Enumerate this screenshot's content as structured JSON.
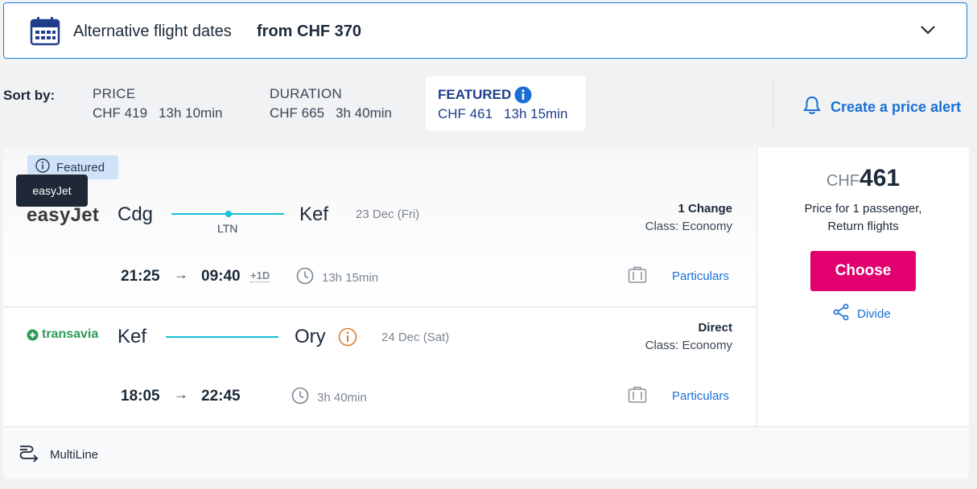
{
  "alt_dates": {
    "label": "Alternative flight dates",
    "price": "from CHF 370"
  },
  "sort": {
    "label": "Sort by:",
    "options": [
      {
        "title": "PRICE",
        "price": "CHF 419",
        "duration": "13h 10min"
      },
      {
        "title": "DURATION",
        "price": "CHF 665",
        "duration": "3h 40min"
      },
      {
        "title": "FEATURED",
        "price": "CHF 461",
        "duration": "13h 15min",
        "selected": true
      }
    ]
  },
  "price_alert": "Create a price alert",
  "result": {
    "badge": "Featured",
    "tooltip": "easyJet",
    "legs": [
      {
        "airline": "easyJet",
        "from": "Cdg",
        "to": "Kef",
        "stop": "LTN",
        "date": "23 Dec (Fri)",
        "changes": "1 Change",
        "class": "Class: Economy",
        "depart": "21:25",
        "arrive": "09:40",
        "plus_day": "+1D",
        "duration": "13h 15min",
        "details": "Particulars"
      },
      {
        "airline": "transavia",
        "from": "Kef",
        "to": "Ory",
        "date": "24 Dec (Sat)",
        "changes": "Direct",
        "class": "Class: Economy",
        "depart": "18:05",
        "arrive": "22:45",
        "duration": "3h 40min",
        "details": "Particulars"
      }
    ],
    "price": {
      "currency": "CHF",
      "amount": "461",
      "note1": "Price for 1 passenger,",
      "note2": "Return flights"
    },
    "choose": "Choose",
    "divide": "Divide",
    "footer": "MultiLine"
  },
  "colors": {
    "accent": "#1a6fd6",
    "choose": "#e2006f",
    "route": "#17c2d8",
    "featured_badge": "#cfe2f7",
    "warning": "#e07b28"
  },
  "icons": [
    "calendar-icon",
    "chevron-down-icon",
    "info-icon",
    "bell-icon",
    "clock-icon",
    "luggage-icon",
    "share-icon",
    "multiline-icon",
    "warning-icon"
  ]
}
